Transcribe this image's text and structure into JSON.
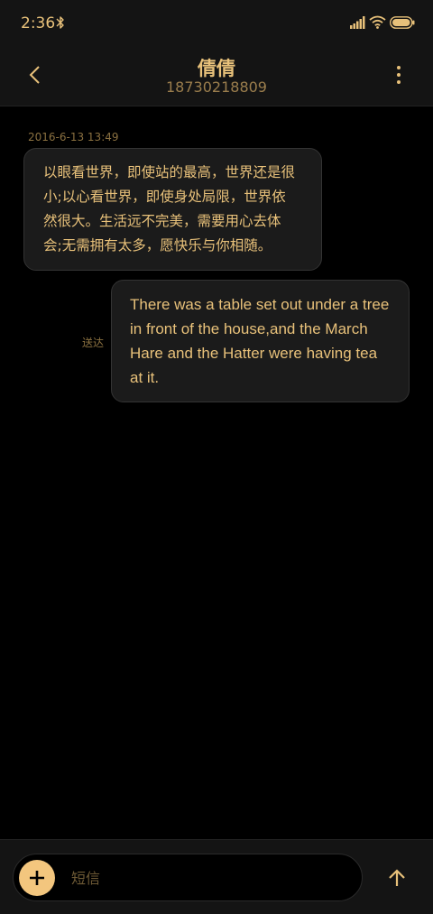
{
  "status_bar": {
    "time": "2:36",
    "icons": [
      "bluetooth-icon",
      "signal-icon",
      "wifi-icon",
      "battery-icon"
    ]
  },
  "header": {
    "contact_name": "倩倩",
    "contact_number": "18730218809",
    "icons": [
      "chevron-left-icon",
      "more-vertical-icon"
    ]
  },
  "conversation": {
    "timestamp": "2016-6-13 13:49",
    "incoming_message": {
      "lines": [
        "以眼看世界，即使站的最高，世界还是很",
        "小;以心看世界，即使身处局限，世界依",
        "然很大。生活远不完美，需要用心去体",
        "会;无需拥有太多，愿快乐与你相随。"
      ]
    },
    "outgoing_message": {
      "lines": [
        "There was a table set out under a tree",
        "in front of the house,and the March",
        "Hare and the Hatter were having tea",
        "at it."
      ],
      "status": "送达"
    }
  },
  "composer": {
    "placeholder": "短信",
    "icons": [
      "plus-icon",
      "send-arrow-up-icon"
    ]
  },
  "colors": {
    "background": "#000000",
    "bar_background": "#141414",
    "bubble_background": "#1b1b1b",
    "accent": "#e8c17a",
    "accent_button": "#f3c67e",
    "muted": "#8a7040"
  }
}
